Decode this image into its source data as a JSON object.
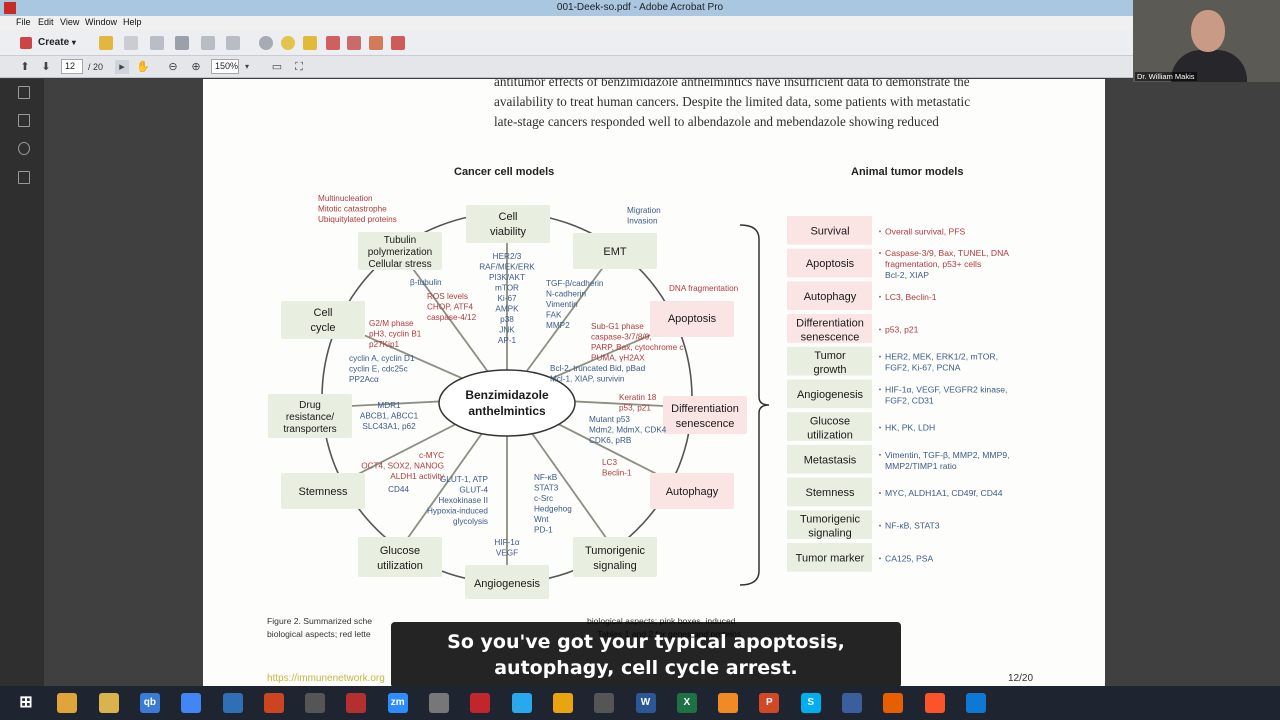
{
  "window": {
    "title": "001-Deek-so.pdf - Adobe Acrobat Pro"
  },
  "menu": [
    "File",
    "Edit",
    "View",
    "Window",
    "Help"
  ],
  "toolbar": {
    "create_label": "Create"
  },
  "nav": {
    "page_current": "12",
    "page_total": "/ 20",
    "zoom": "150%"
  },
  "document": {
    "paragraph_lines": [
      "antitumor effects of benzimidazole anthelmintics have insufficient data to demonstrate the",
      "availability to treat human cancers. Despite the limited data, some patients with metastatic",
      "late-stage cancers responded well to albendazole and mebendazole showing reduced"
    ],
    "header_left": "Cancer cell models",
    "header_right": "Animal tumor models",
    "center_label_1": "Benzimidazole",
    "center_label_2": "anthelmintics",
    "wheel_boxes": [
      {
        "l1": "Cell",
        "l2": "viability"
      },
      {
        "l1": "EMT",
        "l2": ""
      },
      {
        "l1": "Apoptosis",
        "l2": ""
      },
      {
        "l1": "Differentiation",
        "l2": "senescence"
      },
      {
        "l1": "Autophagy",
        "l2": ""
      },
      {
        "l1": "Tumorigenic",
        "l2": "signaling"
      },
      {
        "l1": "Angiogenesis",
        "l2": ""
      },
      {
        "l1": "Glucose",
        "l2": "utilization"
      },
      {
        "l1": "Stemness",
        "l2": ""
      },
      {
        "l1": "Drug",
        "l2": "resistance/",
        "l3": "transporters"
      },
      {
        "l1": "Cell",
        "l2": "cycle"
      },
      {
        "l1": "Tubulin",
        "l2": "polymerization",
        "l3": "Cellular stress"
      }
    ],
    "annotations": {
      "multinucleation": [
        "Multinucleation",
        "Mitotic catastrophe",
        "Ubiquitylated proteins"
      ],
      "migration": [
        "Migration",
        "Invasion"
      ],
      "dna_frag": "DNA fragmentation",
      "viability_list": [
        "HER2/3",
        "RAF/MEK/ERK",
        "PI3K/AKT",
        "mTOR",
        "Ki-67",
        "AMPK",
        "p38",
        "JNK",
        "AP-1"
      ],
      "emt_list": [
        "TGF-β/cadherin",
        "N-cadherin",
        "Vimentin",
        "FAK",
        "MMP2"
      ],
      "apoptosis_red": [
        "Sub-G1 phase",
        "caspase-3/7/8/9,",
        "PARP, Bax, cytochrome c",
        "PUMA, γH2AX"
      ],
      "apoptosis_blue": [
        "Bcl-2, truncated Bid, pBad",
        "Mcl-1, XIAP, survivin"
      ],
      "diff_red": [
        "Keratin 18",
        "p53, p21"
      ],
      "diff_blue": [
        "Mutant p53",
        "Mdm2, MdmX, CDK4",
        "CDK6, pRB"
      ],
      "autophagy_red": [
        "LC3",
        "Beclin-1"
      ],
      "tumorigenic_list": [
        "NF-κB",
        "STAT3",
        "c-Src",
        "Hedgehog",
        "Wnt",
        "PD-1"
      ],
      "angio_list": [
        "HIF-1α",
        "VEGF"
      ],
      "glucose_list": [
        "GLUT-1, ATP",
        "GLUT-4",
        "Hexokinase II",
        "Hypoxia-induced",
        "glycolysis"
      ],
      "stem_red": [
        "c-MYC",
        "OCT4, SOX2, NANOG",
        "ALDH1 activity"
      ],
      "stem_blue": [
        "CD44"
      ],
      "drug_list": [
        "MDR1",
        "ABCB1, ABCC1",
        "SLC43A1, p62"
      ],
      "cycle_red": [
        "G2/M phase",
        "pH3, cyclin B1",
        "p27Kip1"
      ],
      "cycle_blue": [
        "cyclin A, cyclin D1",
        "cyclin E, cdc25c",
        "PP2Acα"
      ],
      "tubulin_blue": [
        "β-tubulin"
      ],
      "tubulin_red": [
        "ROS levels",
        "CHOP, ATF4",
        "caspase-4/12"
      ]
    },
    "animal_table": [
      {
        "label": [
          "Survival"
        ],
        "pink": true,
        "desc": [
          "Overall survival, PFS"
        ],
        "color": "red"
      },
      {
        "label": [
          "Apoptosis"
        ],
        "pink": true,
        "desc": [
          "Caspase-3/9, Bax, TUNEL, DNA",
          "fragmentation, p53+ cells"
        ],
        "desc_b": [
          "Bcl-2, XIAP"
        ],
        "color": "red"
      },
      {
        "label": [
          "Autophagy"
        ],
        "pink": true,
        "desc": [
          "LC3, Beclin-1"
        ],
        "color": "red"
      },
      {
        "label": [
          "Differentiation",
          "senescence"
        ],
        "pink": true,
        "desc": [
          "p53, p21"
        ],
        "color": "red"
      },
      {
        "label": [
          "Tumor",
          "growth"
        ],
        "pink": false,
        "desc": [
          "HER2, MEK, ERK1/2, mTOR,",
          "FGF2, Ki-67, PCNA"
        ],
        "color": "blue"
      },
      {
        "label": [
          "Angiogenesis"
        ],
        "pink": false,
        "desc": [
          "HIF-1α, VEGF, VEGFR2 kinase,",
          "FGF2, CD31"
        ],
        "color": "blue"
      },
      {
        "label": [
          "Glucose",
          "utilization"
        ],
        "pink": false,
        "desc": [
          "HK, PK, LDH"
        ],
        "color": "blue"
      },
      {
        "label": [
          "Metastasis"
        ],
        "pink": false,
        "desc": [
          "Vimentin, TGF-β, MMP2, MMP9,",
          "MMP2/TIMP1 ratio"
        ],
        "color": "blue"
      },
      {
        "label": [
          "Stemness"
        ],
        "pink": false,
        "desc": [
          "MYC, ALDH1A1, CD49f, CD44"
        ],
        "color": "blue"
      },
      {
        "label": [
          "Tumorigenic",
          "signaling"
        ],
        "pink": false,
        "desc": [
          "NF-κB, STAT3"
        ],
        "color": "blue"
      },
      {
        "label": [
          "Tumor marker"
        ],
        "pink": false,
        "desc": [
          "CA125, PSA"
        ],
        "color": "blue"
      }
    ],
    "caption_line1": "Figure 2. Summarized sche                                                                                          biological aspects; pink boxes, induced",
    "caption_line2": "biological aspects; red lette                                                                                               Tables 1 and 2 for genes and proteins.",
    "footer_link": "https://immunenetwork.org",
    "page_number": "12/20"
  },
  "subtitle": {
    "line1": "So you've got your typical apoptosis,",
    "line2": "autophagy, cell cycle arrest."
  },
  "webcam": {
    "name": "Dr. William Makis"
  },
  "colors": {
    "titlebar": "#a9c7e0",
    "pink_box": "#fbe4e4",
    "green_box": "#e8eee0",
    "red_text": "#b23a3a",
    "blue_text": "#3b5a86"
  },
  "taskbar": [
    "start-icon",
    "explorer-icon",
    "folder-icon",
    "qbittorrent-icon",
    "chrome-icon",
    "notepad-icon",
    "app-icon",
    "app-icon",
    "acrobat-icon",
    "zoom-icon",
    "app-icon",
    "acrobat-pro-icon",
    "telegram-icon",
    "app-icon",
    "app-icon",
    "word-icon",
    "excel-icon",
    "vlc-icon",
    "powerpoint-icon",
    "skype-icon",
    "app-icon",
    "firefox-icon",
    "brave-icon",
    "edge-icon"
  ]
}
